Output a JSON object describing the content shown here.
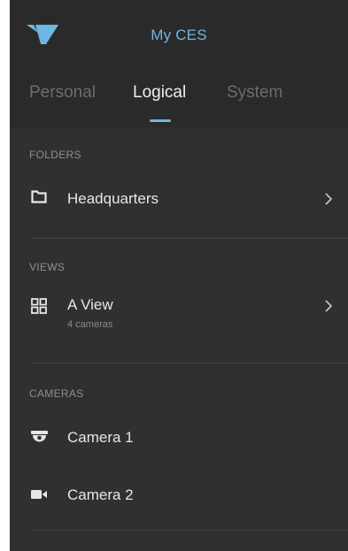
{
  "header": {
    "title": "My CES",
    "logo_icon": "brand-logo-icon",
    "accent_color": "#6fb6e3"
  },
  "tabs": [
    {
      "label": "Personal",
      "active": false
    },
    {
      "label": "Logical",
      "active": true
    },
    {
      "label": "System",
      "active": false
    }
  ],
  "folders": {
    "label": "FOLDERS",
    "items": [
      {
        "name": "Headquarters",
        "icon": "folder-icon"
      }
    ]
  },
  "views": {
    "label": "VIEWS",
    "items": [
      {
        "name": "A View",
        "subtitle": "4 cameras",
        "icon": "grid-view-icon"
      }
    ]
  },
  "cameras": {
    "label": "CAMERAS",
    "items": [
      {
        "name": "Camera 1",
        "icon": "dome-camera-icon"
      },
      {
        "name": "Camera 2",
        "icon": "video-camera-icon"
      }
    ]
  }
}
